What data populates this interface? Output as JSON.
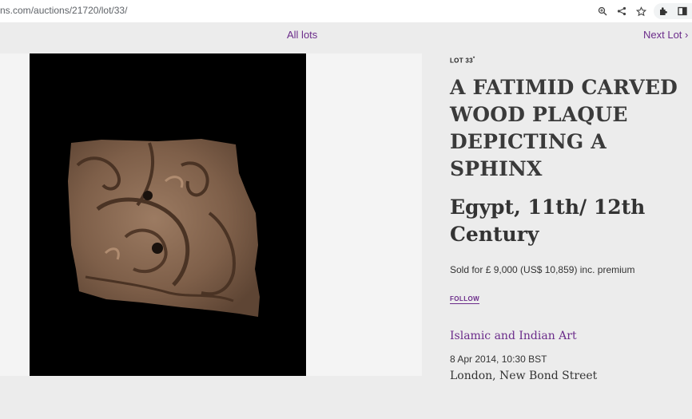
{
  "browser": {
    "url_domain": "ns.com",
    "url_path": "/auctions/21720/lot/33/",
    "icons": [
      "zoom-icon",
      "share-icon",
      "star-icon",
      "extensions-icon",
      "side-panel-icon"
    ]
  },
  "nav": {
    "all_lots": "All lots",
    "next_lot": "Next Lot",
    "next_arrow": "›"
  },
  "lot": {
    "label": "LOT 33",
    "marker": "*",
    "title": "A FATIMID CARVED WOOD PLAQUE DEPICTING A SPHINX",
    "subtitle": "Egypt, 11th/ 12th Century",
    "sold": "Sold for £ 9,000 (US$ 10,859) inc. premium",
    "follow": "FOLLOW",
    "department": "Islamic and Indian Art",
    "date": "8 Apr 2014, 10:30 BST",
    "location": "London, New Bond Street"
  },
  "colors": {
    "accent": "#6b2c8a",
    "background": "#ececec",
    "image_bg": "#000000"
  }
}
